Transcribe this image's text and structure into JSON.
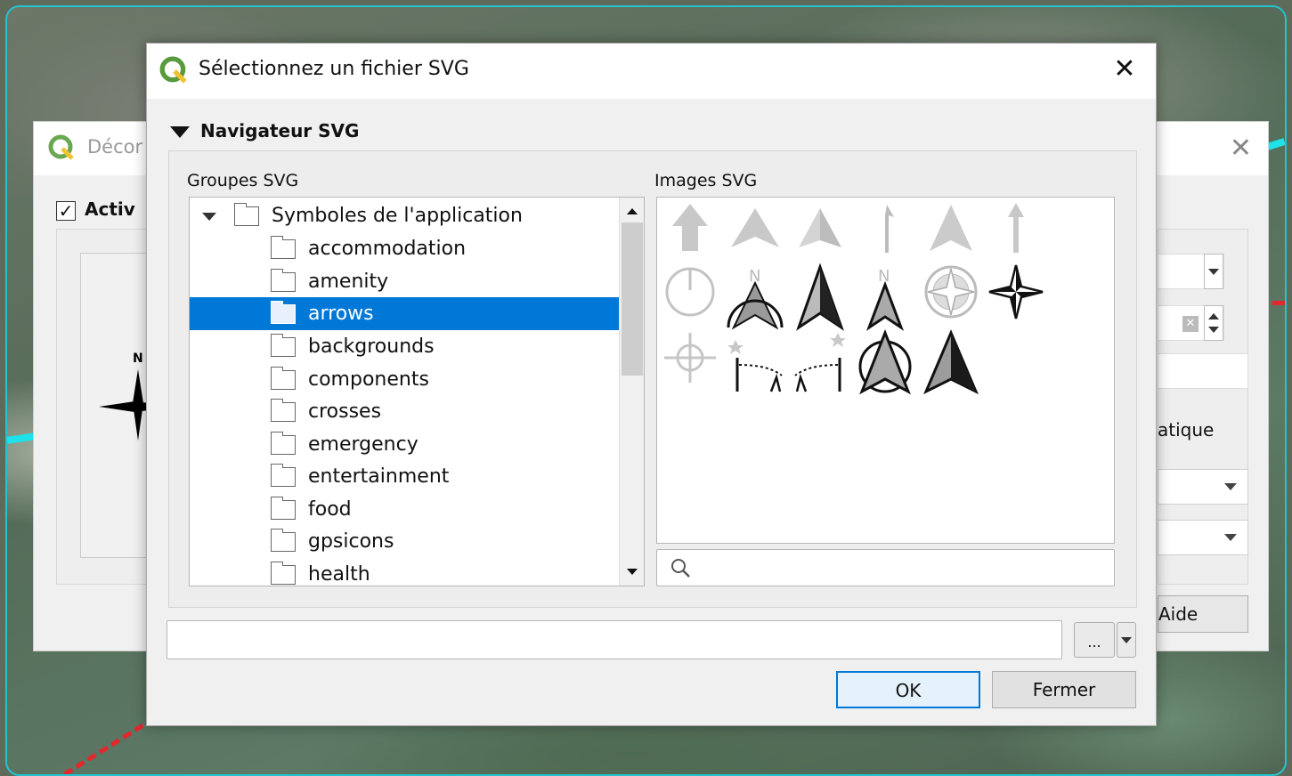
{
  "background_dialog": {
    "title": "Décor",
    "enable_label": "Activ",
    "check_mark": "✓",
    "preview_letter": "N",
    "label_partial": "atique",
    "help_button": "Aide",
    "close_glyph": "✕"
  },
  "dialog": {
    "title": "Sélectionnez un fichier SVG",
    "close_glyph": "✕",
    "section_title": "Navigateur SVG",
    "groups_label": "Groupes SVG",
    "images_label": "Images SVG",
    "tree": {
      "root": "Symboles de l'application",
      "items": [
        "accommodation",
        "amenity",
        "arrows",
        "backgrounds",
        "components",
        "crosses",
        "emergency",
        "entertainment",
        "food",
        "gpsicons",
        "health"
      ],
      "selected": "arrows"
    },
    "search": {
      "value": "",
      "placeholder": ""
    },
    "path": {
      "value": ""
    },
    "browse_label": "...",
    "ok_label": "OK",
    "close_label": "Fermer",
    "north_letter": "N",
    "images": [
      "arrow-up-gray-icon",
      "navigation-arrow-gray-icon",
      "navigation-arrow-half-gray-icon",
      "thin-north-arrow-icon",
      "tall-arrowhead-gray-icon",
      "thin-arrow-up-icon",
      "power-circle-icon",
      "north-arrow-circle-icon",
      "north-arrow-black-icon",
      "north-arrow-labeled-icon",
      "compass-rose-icon",
      "four-point-star-icon",
      "crosshair-target-icon",
      "north-arc-left-icon",
      "north-arc-right-icon",
      "north-arrow-ring-icon",
      "arrowhead-black-icon"
    ]
  },
  "colors": {
    "selection": "#0078d7",
    "accent_cyan": "#1de2ea",
    "accent_red": "#e3272c"
  }
}
